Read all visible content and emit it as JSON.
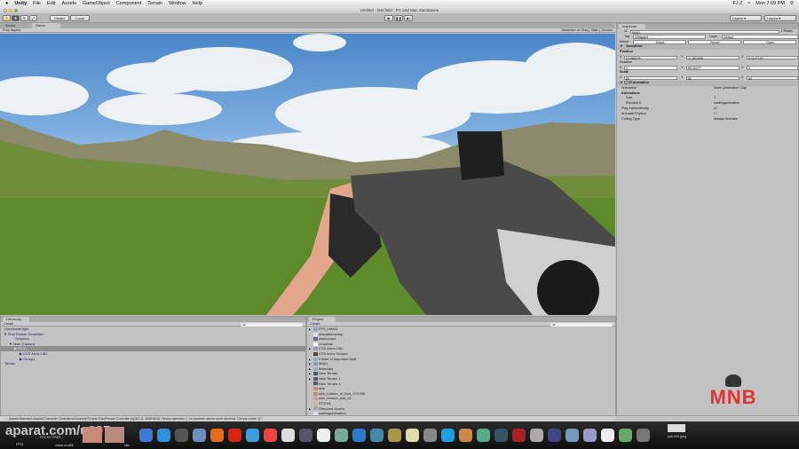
{
  "menubar": {
    "apple": "",
    "app": "Unity",
    "items": [
      "File",
      "Edit",
      "Assets",
      "GameObject",
      "Component",
      "Terrain",
      "Window",
      "Help"
    ],
    "status": [
      "FJ 2",
      "Mon 7:09 PM"
    ]
  },
  "window": {
    "title": "Untitled - test field - PC and Mac Standalone"
  },
  "toolbar": {
    "center": "Center",
    "local": "Local",
    "layers": "Layers",
    "layout": "Layout"
  },
  "game_panel": {
    "tabs": [
      "Scene",
      "Game"
    ],
    "aspect": "Free Aspect",
    "options": [
      "Maximize on Play",
      "Stats",
      "Gizmos"
    ]
  },
  "inspector": {
    "tab": "Inspector",
    "object_name": "M4A1",
    "static": "Static",
    "tag_label": "Tag",
    "tag": "Untagged",
    "layer_label": "Layer",
    "layer": "Default",
    "model_label": "Model",
    "model_buttons": [
      "Select",
      "Revert",
      "Open"
    ],
    "transform": {
      "title": "Transform",
      "position_label": "Position",
      "position": {
        "x": "0.1666195",
        "y": "-0.1812691",
        "z": "0.2147194"
      },
      "rotation_label": "Rotation",
      "rotation": {
        "x": "0",
        "y": "89.40477",
        "z": "0"
      },
      "scale_label": "Scale",
      "scale": {
        "x": "80",
        "y": "80",
        "z": "80"
      }
    },
    "animation": {
      "title": "Animation",
      "animation_label": "Animation",
      "animation_value": "None (Animation Clip)",
      "animations_label": "Animations",
      "size_label": "Size",
      "size": "1",
      "element_label": "Element 0",
      "element": "walkinganimation",
      "play_auto": "Play Automatically",
      "animate_physics": "Animate Physics",
      "culling_label": "Culling Type",
      "culling": "Always Animate"
    }
  },
  "hierarchy": {
    "tab": "Hierarchy",
    "create": "Create",
    "search": "All",
    "items": [
      {
        "label": "Directional light",
        "indent": 0,
        "arrow": ""
      },
      {
        "label": "First Person Controller",
        "indent": 0,
        "arrow": "▼"
      },
      {
        "label": "Graphics",
        "indent": 2,
        "arrow": ""
      },
      {
        "label": "Main Camera",
        "indent": 1,
        "arrow": "▼"
      },
      {
        "label": "M4A1",
        "indent": 2,
        "arrow": "▶",
        "selected": true
      },
      {
        "label": "CSS Arms OBJ",
        "indent": 3,
        "arrow": "▶"
      },
      {
        "label": "Group1",
        "indent": 3,
        "arrow": "▶"
      },
      {
        "label": "Terrain",
        "indent": 0,
        "arrow": ""
      }
    ]
  },
  "project": {
    "tab": "Project",
    "create": "Create",
    "search": "All",
    "items": [
      {
        "label": "FPS_HAND",
        "arrow": "▶",
        "icon": "#8aa0c8"
      },
      {
        "label": "animationsetup",
        "arrow": "",
        "icon": "#dde"
      },
      {
        "label": "awesomee",
        "arrow": "",
        "icon": "#668"
      },
      {
        "label": "crosshair",
        "arrow": "",
        "icon": "#fff"
      },
      {
        "label": "CSS Arms OBJ",
        "arrow": "▶",
        "icon": "#8aa0c8"
      },
      {
        "label": "CSS Arms Texture",
        "arrow": "",
        "icon": "#543"
      },
      {
        "label": "Folder of important stuff",
        "arrow": "▶",
        "icon": "#9ab"
      },
      {
        "label": "M4A1",
        "arrow": "▶",
        "icon": "#8aa0c8"
      },
      {
        "label": "Materials",
        "arrow": "▶",
        "icon": "#9ab"
      },
      {
        "label": "New Terrain",
        "arrow": "▶",
        "icon": "#557"
      },
      {
        "label": "New Terrain 1",
        "arrow": "▶",
        "icon": "#557"
      },
      {
        "label": "New Terrain 2",
        "arrow": "",
        "icon": "#557"
      },
      {
        "label": "skin",
        "arrow": "",
        "icon": "#c98a6a"
      },
      {
        "label": "skin_bottom_of_foot_ST1258",
        "arrow": "",
        "icon": "#c98a6a"
      },
      {
        "label": "skin_texture_test_01",
        "arrow": "",
        "icon": "#c9a08a"
      },
      {
        "label": "ST0031",
        "arrow": "",
        "icon": "#e0b090"
      },
      {
        "label": "Standard Assets",
        "arrow": "▶",
        "icon": "#9ab"
      },
      {
        "label": "walkinganimation",
        "arrow": "",
        "icon": "#dde"
      }
    ]
  },
  "status": "Assets/Standard Assets/Character Controllers/Sources/Scripts/ThirdPerson Controller.js(163,3): WARNING: Binary operation '|' on boolean values won't shortcut. Did you mean '||'?",
  "dock": {
    "left_labels": [
      "FPS1",
      "FPS KIT FREE",
      "nickel-mod55",
      "skin"
    ],
    "right_label": "parr-003.jpeg"
  },
  "watermark": "aparat.com/u007",
  "logo": "MNB"
}
